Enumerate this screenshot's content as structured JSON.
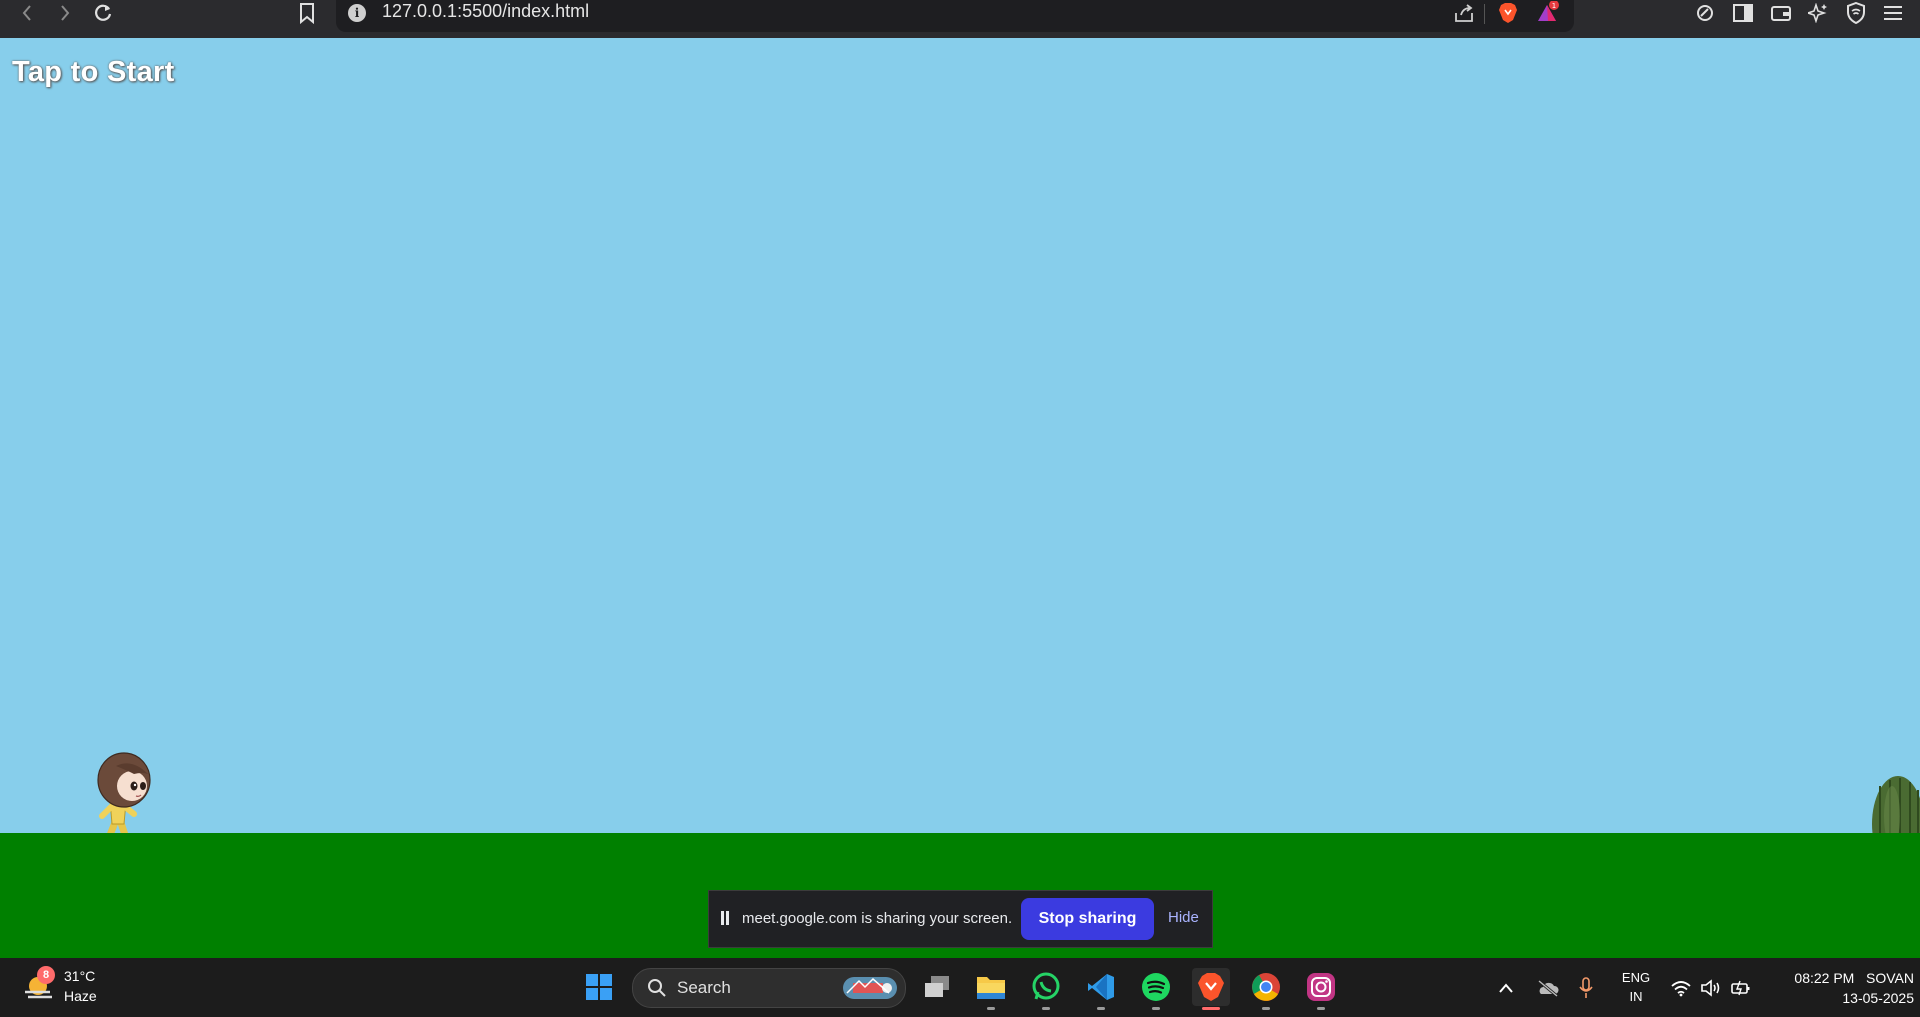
{
  "browser": {
    "url": "127.0.0.1:5500/index.html",
    "notification_count": "1"
  },
  "game": {
    "prompt": "Tap to Start",
    "sky_color": "#87ceeb",
    "ground_color": "#008000"
  },
  "share_bar": {
    "message": "meet.google.com is sharing your screen.",
    "stop_label": "Stop sharing",
    "hide_label": "Hide"
  },
  "taskbar": {
    "weather_badge": "8",
    "temperature": "31°C",
    "condition": "Haze",
    "search_label": "Search",
    "language": "ENG",
    "region": "IN",
    "time": "08:22 PM",
    "user": "SOVAN",
    "date": "13-05-2025"
  }
}
